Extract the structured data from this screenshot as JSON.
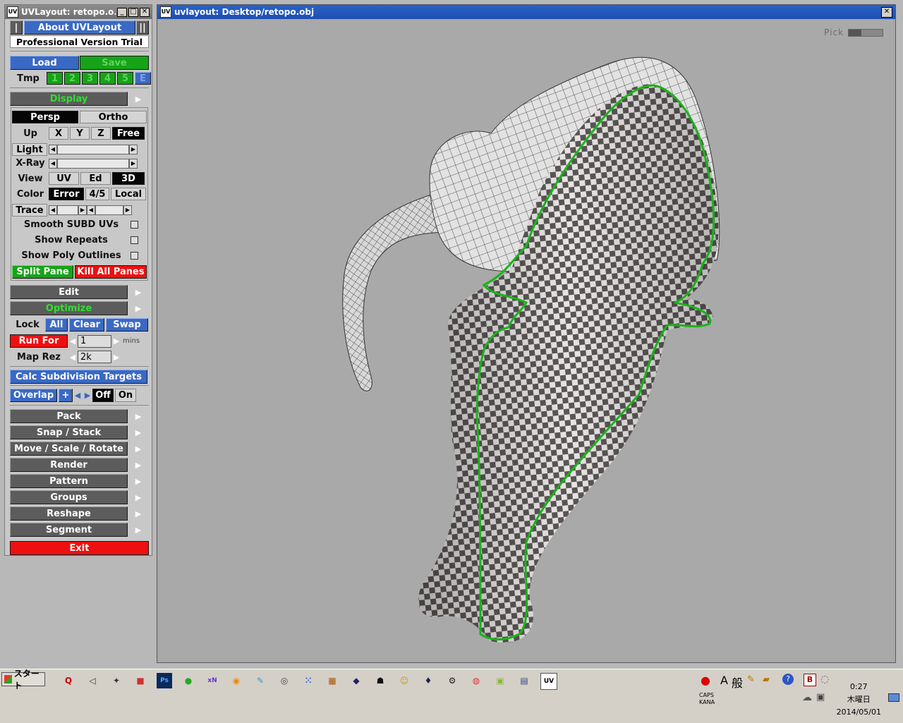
{
  "side_window": {
    "title": "UVLayout: retopo.o...",
    "about": "About UVLayout",
    "version": "Professional Version Trial",
    "load": "Load",
    "save": "Save",
    "tmp_label": "Tmp",
    "tmp_slots": [
      "1",
      "2",
      "3",
      "4",
      "5",
      "E"
    ],
    "display": "Display",
    "persp": "Persp",
    "ortho": "Ortho",
    "up_label": "Up",
    "up_axes": [
      "X",
      "Y",
      "Z",
      "Free"
    ],
    "light": "Light",
    "xray": "X-Ray",
    "view_label": "View",
    "view_opts": [
      "UV",
      "Ed",
      "3D"
    ],
    "color_label": "Color",
    "color_opts": [
      "Error",
      "4/5",
      "Local"
    ],
    "trace": "Trace",
    "smooth_subd": "Smooth SUBD UVs",
    "show_repeats": "Show Repeats",
    "show_poly_outlines": "Show Poly Outlines",
    "split_pane": "Split Pane",
    "kill_all_panes": "Kill All Panes",
    "edit": "Edit",
    "optimize": "Optimize",
    "lock_label": "Lock",
    "lock_opts": [
      "All",
      "Clear",
      "Swap"
    ],
    "run_for": "Run For",
    "run_for_value": "1",
    "mins": "mins",
    "map_rez": "Map Rez",
    "map_rez_value": "2k",
    "calc_subdiv": "Calc Subdivision Targets",
    "overlap": "Overlap",
    "overlap_plus": "+",
    "overlap_off": "Off",
    "overlap_on": "On",
    "menus": [
      "Pack",
      "Snap / Stack",
      "Move / Scale / Rotate",
      "Render",
      "Pattern",
      "Groups",
      "Reshape",
      "Segment"
    ],
    "exit": "Exit"
  },
  "viewport": {
    "title": "uvlayout: Desktop/retopo.obj",
    "pick": "Pick"
  },
  "taskbar": {
    "start": "スタート",
    "ime": [
      "A",
      "般"
    ],
    "caps": "CAPS",
    "kana": "KANA",
    "time": "0:27",
    "weekday": "木曜日",
    "date": "2014/05/01"
  },
  "colors": {
    "seam": "#18b418",
    "accent_blue": "#3a69c4",
    "accent_green": "#17a317",
    "accent_red": "#ee1010"
  }
}
